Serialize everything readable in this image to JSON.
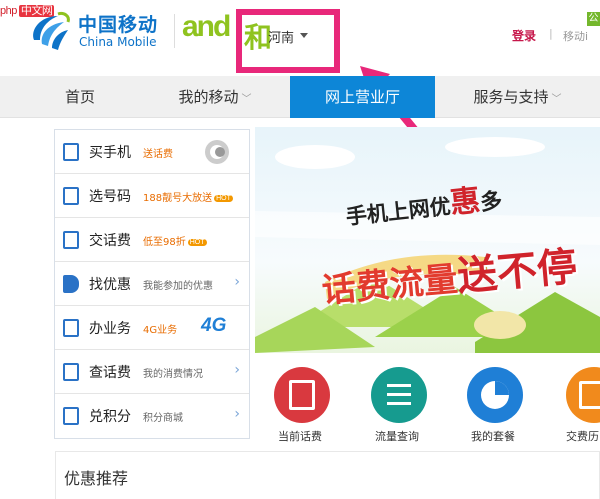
{
  "watermark": {
    "prefix": "php",
    "site": "中文网"
  },
  "brand": {
    "name_cn": "中国移动",
    "name_en": "China Mobile",
    "sub_brand_glyph": "and",
    "sub_brand_he": "和"
  },
  "province": {
    "name": "河南"
  },
  "top_links": {
    "login": "登录",
    "divider": "|",
    "mobile": "移动i",
    "gong_badge": "公"
  },
  "nav": [
    {
      "label": "首页",
      "chevron": ""
    },
    {
      "label": "我的移动",
      "chevron": "﹀"
    },
    {
      "label": "网上营业厅",
      "chevron": ""
    },
    {
      "label": "服务与支持",
      "chevron": "﹀"
    }
  ],
  "sidebar": [
    {
      "title": "买手机",
      "desc": "送话费",
      "hot": "",
      "icon": "phone-icon"
    },
    {
      "title": "选号码",
      "desc": "188靓号大放送",
      "hot": "HOT",
      "icon": "sim-card-icon"
    },
    {
      "title": "交话费",
      "desc": "低至98折",
      "hot": "HOT",
      "icon": "payment-icon"
    },
    {
      "title": "找优惠",
      "desc": "我能参加的优惠",
      "hot": "",
      "icon": "tag-icon"
    },
    {
      "title": "办业务",
      "desc": "4G业务",
      "hot": "",
      "icon": "service-icon"
    },
    {
      "title": "查话费",
      "desc": "我的消费情况",
      "hot": "",
      "icon": "bill-icon"
    },
    {
      "title": "兑积分",
      "desc": "积分商城",
      "hot": "",
      "icon": "points-icon"
    }
  ],
  "banner": {
    "line1": "手机上网优",
    "line1_big": "惠",
    "line1_end": "多",
    "line2": "话费流量",
    "line2_big": "送不停"
  },
  "badges": {
    "g4": "4G"
  },
  "services": [
    {
      "label": "当前话费",
      "color": "#d9393f",
      "icon": "current-bill-icon"
    },
    {
      "label": "流量查询",
      "color": "#169b8f",
      "icon": "data-query-icon"
    },
    {
      "label": "我的套餐",
      "color": "#1f7fd6",
      "icon": "my-plan-icon"
    },
    {
      "label": "交费历",
      "color": "#f18a1c",
      "icon": "payment-history-icon"
    }
  ],
  "section": {
    "title": "优惠推荐"
  }
}
